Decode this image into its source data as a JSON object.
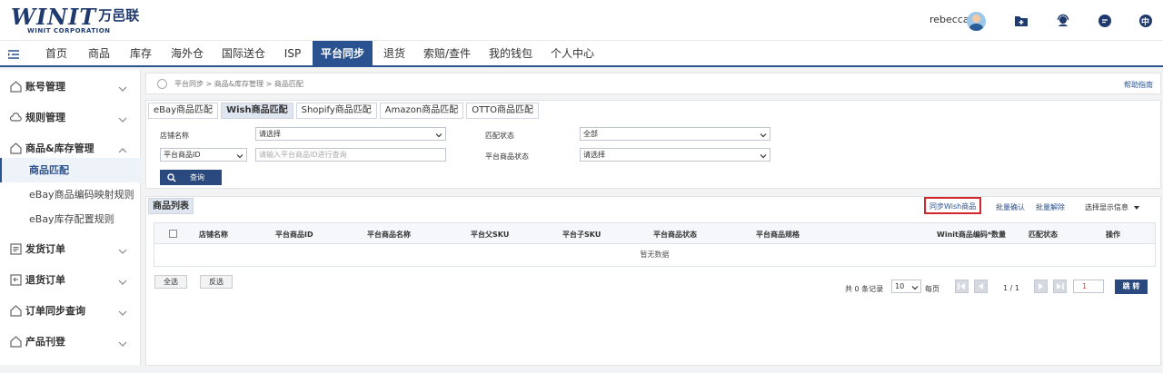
{
  "header": {
    "logo_mark": "WINIT",
    "logo_cn": "万邑联",
    "logo_sub": "WINIT CORPORATION",
    "username": "rebecca",
    "icons": [
      "folder-plus-icon",
      "support-agent-icon",
      "chat-icon",
      "language-icon"
    ],
    "language_label": "中"
  },
  "nav": {
    "items": [
      "首页",
      "商品",
      "库存",
      "海外仓",
      "国际送仓",
      "ISP",
      "平台同步",
      "退货",
      "索赔/查件",
      "我的钱包",
      "个人中心"
    ],
    "active": "平台同步"
  },
  "sidebar": {
    "groups": [
      {
        "label": "账号管理",
        "icon": "home-icon"
      },
      {
        "label": "规则管理",
        "icon": "cloud-icon"
      },
      {
        "label": "商品&库存管理",
        "icon": "home-icon"
      },
      {
        "label": "发货订单",
        "icon": "list-icon"
      },
      {
        "label": "退货订单",
        "icon": "return-icon"
      },
      {
        "label": "订单同步查询",
        "icon": "home-icon"
      },
      {
        "label": "产品刊登",
        "icon": "home-icon"
      }
    ],
    "subitems": [
      "商品匹配",
      "eBay商品编码映射规则",
      "eBay库存配置规则"
    ]
  },
  "breadcrumb": {
    "text": "平台同步 > 商品&库存管理 > 商品匹配",
    "help": "帮助指南"
  },
  "tabs": [
    "eBay商品匹配",
    "Wish商品匹配",
    "Shopify商品匹配",
    "Amazon商品匹配",
    "OTTO商品匹配"
  ],
  "active_tab": "Wish商品匹配",
  "filters": {
    "store_label": "店铺名称",
    "store_value": "请选择",
    "match_status_label": "匹配状态",
    "match_status_value": "全部",
    "id_type_value": "平台商品ID",
    "id_placeholder": "请输入平台商品ID进行查询",
    "platform_status_label": "平台商品状态",
    "platform_status_value": "请选择",
    "query_button": "查询"
  },
  "list": {
    "tab": "商品列表",
    "actions": {
      "sync": "同步Wish商品",
      "batch_confirm": "批量确认",
      "batch_unmatch": "批量解除",
      "display": "选择显示信息"
    },
    "columns": [
      "店铺名称",
      "平台商品ID",
      "平台商品名称",
      "平台父SKU",
      "平台子SKU",
      "平台商品状态",
      "平台商品规格",
      "Winit商品编码*数量",
      "匹配状态",
      "操作"
    ],
    "empty": "暂无数据",
    "select_all": "全选",
    "invert": "反选"
  },
  "pager": {
    "total": "共 0 条记录",
    "page_size": "10",
    "per_page": "每页",
    "page_info": "1 / 1",
    "page_input": "1",
    "jump": "跳 转"
  },
  "colors": {
    "primary": "#2a5291",
    "highlight_box": "#d4262c"
  }
}
